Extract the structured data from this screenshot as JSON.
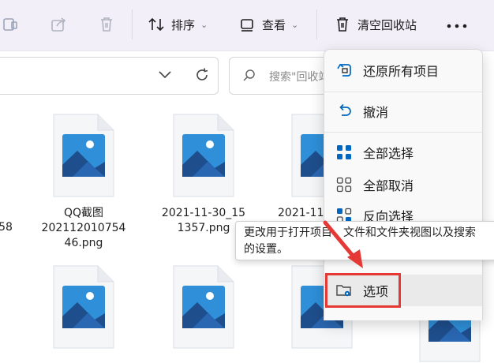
{
  "toolbar": {
    "sort_label": "排序",
    "view_label": "查看",
    "empty_bin_label": "清空回收站"
  },
  "address": {
    "search_placeholder": "搜索\"回收站\""
  },
  "files": [
    {
      "name_l1": "58",
      "name_l2": ""
    },
    {
      "name_l1": "QQ截图",
      "name_l2": "202112010754",
      "name_l3": "46.png"
    },
    {
      "name_l1": "2021-11-30_15",
      "name_l2": "1357.png"
    },
    {
      "name_l1": "2021-11",
      "name_l2": ""
    }
  ],
  "menu": {
    "items": [
      {
        "label": "还原所有项目"
      },
      {
        "label": "撤消"
      },
      {
        "label": "全部选择"
      },
      {
        "label": "全部取消"
      },
      {
        "label": "反向选择"
      },
      {
        "label": "选项"
      }
    ]
  },
  "tooltip": {
    "line1": "更改用于打开项目、文件和文件夹视图以及搜索",
    "line2": "的设置。"
  },
  "colors": {
    "accent": "#0067c0",
    "highlight": "#e53935",
    "toolbar_bg": "#f3eff9"
  }
}
